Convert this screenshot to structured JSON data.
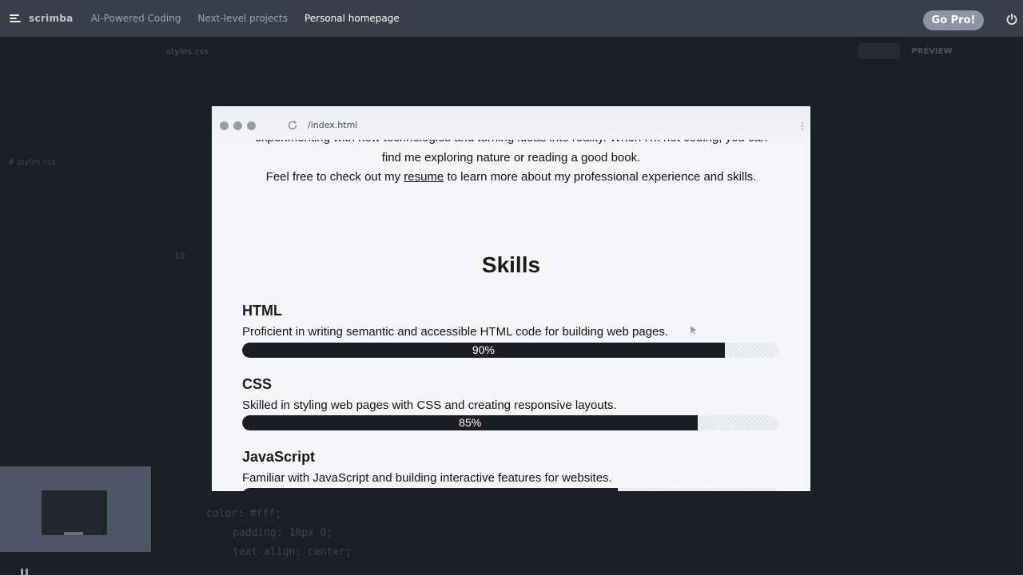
{
  "topbar": {
    "logo_text": "scrimba",
    "nav": [
      "AI-Powered Coding",
      "Next-level projects",
      "Personal homepage"
    ],
    "cta": "Go Pro!"
  },
  "editor": {
    "tab": "styles.css",
    "right_tabs": [
      "",
      "PREVIEW",
      ""
    ],
    "files": [
      "# styles.css"
    ],
    "line_number": "10",
    "code_lines": [
      "color: #fff;",
      "padding: 10px 0;",
      "text-align: center;"
    ]
  },
  "preview": {
    "url": "/index.html",
    "intro_lines": [
      "experimenting with new technologies and turning ideas into reality. When I'm not coding, you can",
      "find me exploring nature or reading a good book."
    ],
    "resume_pre": "Feel free to check out my ",
    "resume_link": "resume",
    "resume_post": " to learn more about my professional experience and skills.",
    "skills_title": "Skills",
    "skills": [
      {
        "name": "HTML",
        "desc": "Proficient in writing semantic and accessible HTML code for building web pages.",
        "percent_label": "90%",
        "percent": 90
      },
      {
        "name": "CSS",
        "desc": "Skilled in styling web pages with CSS and creating responsive layouts.",
        "percent_label": "85%",
        "percent": 85
      },
      {
        "name": "JavaScript",
        "desc": "Familiar with JavaScript and building interactive features for websites.",
        "percent_label": "",
        "percent": 70
      }
    ]
  },
  "colors": {
    "topbar": "#3a3e4b",
    "background": "#1b1e27",
    "progress_fill": "#1c1d22",
    "gopro": "#8e94a6"
  }
}
